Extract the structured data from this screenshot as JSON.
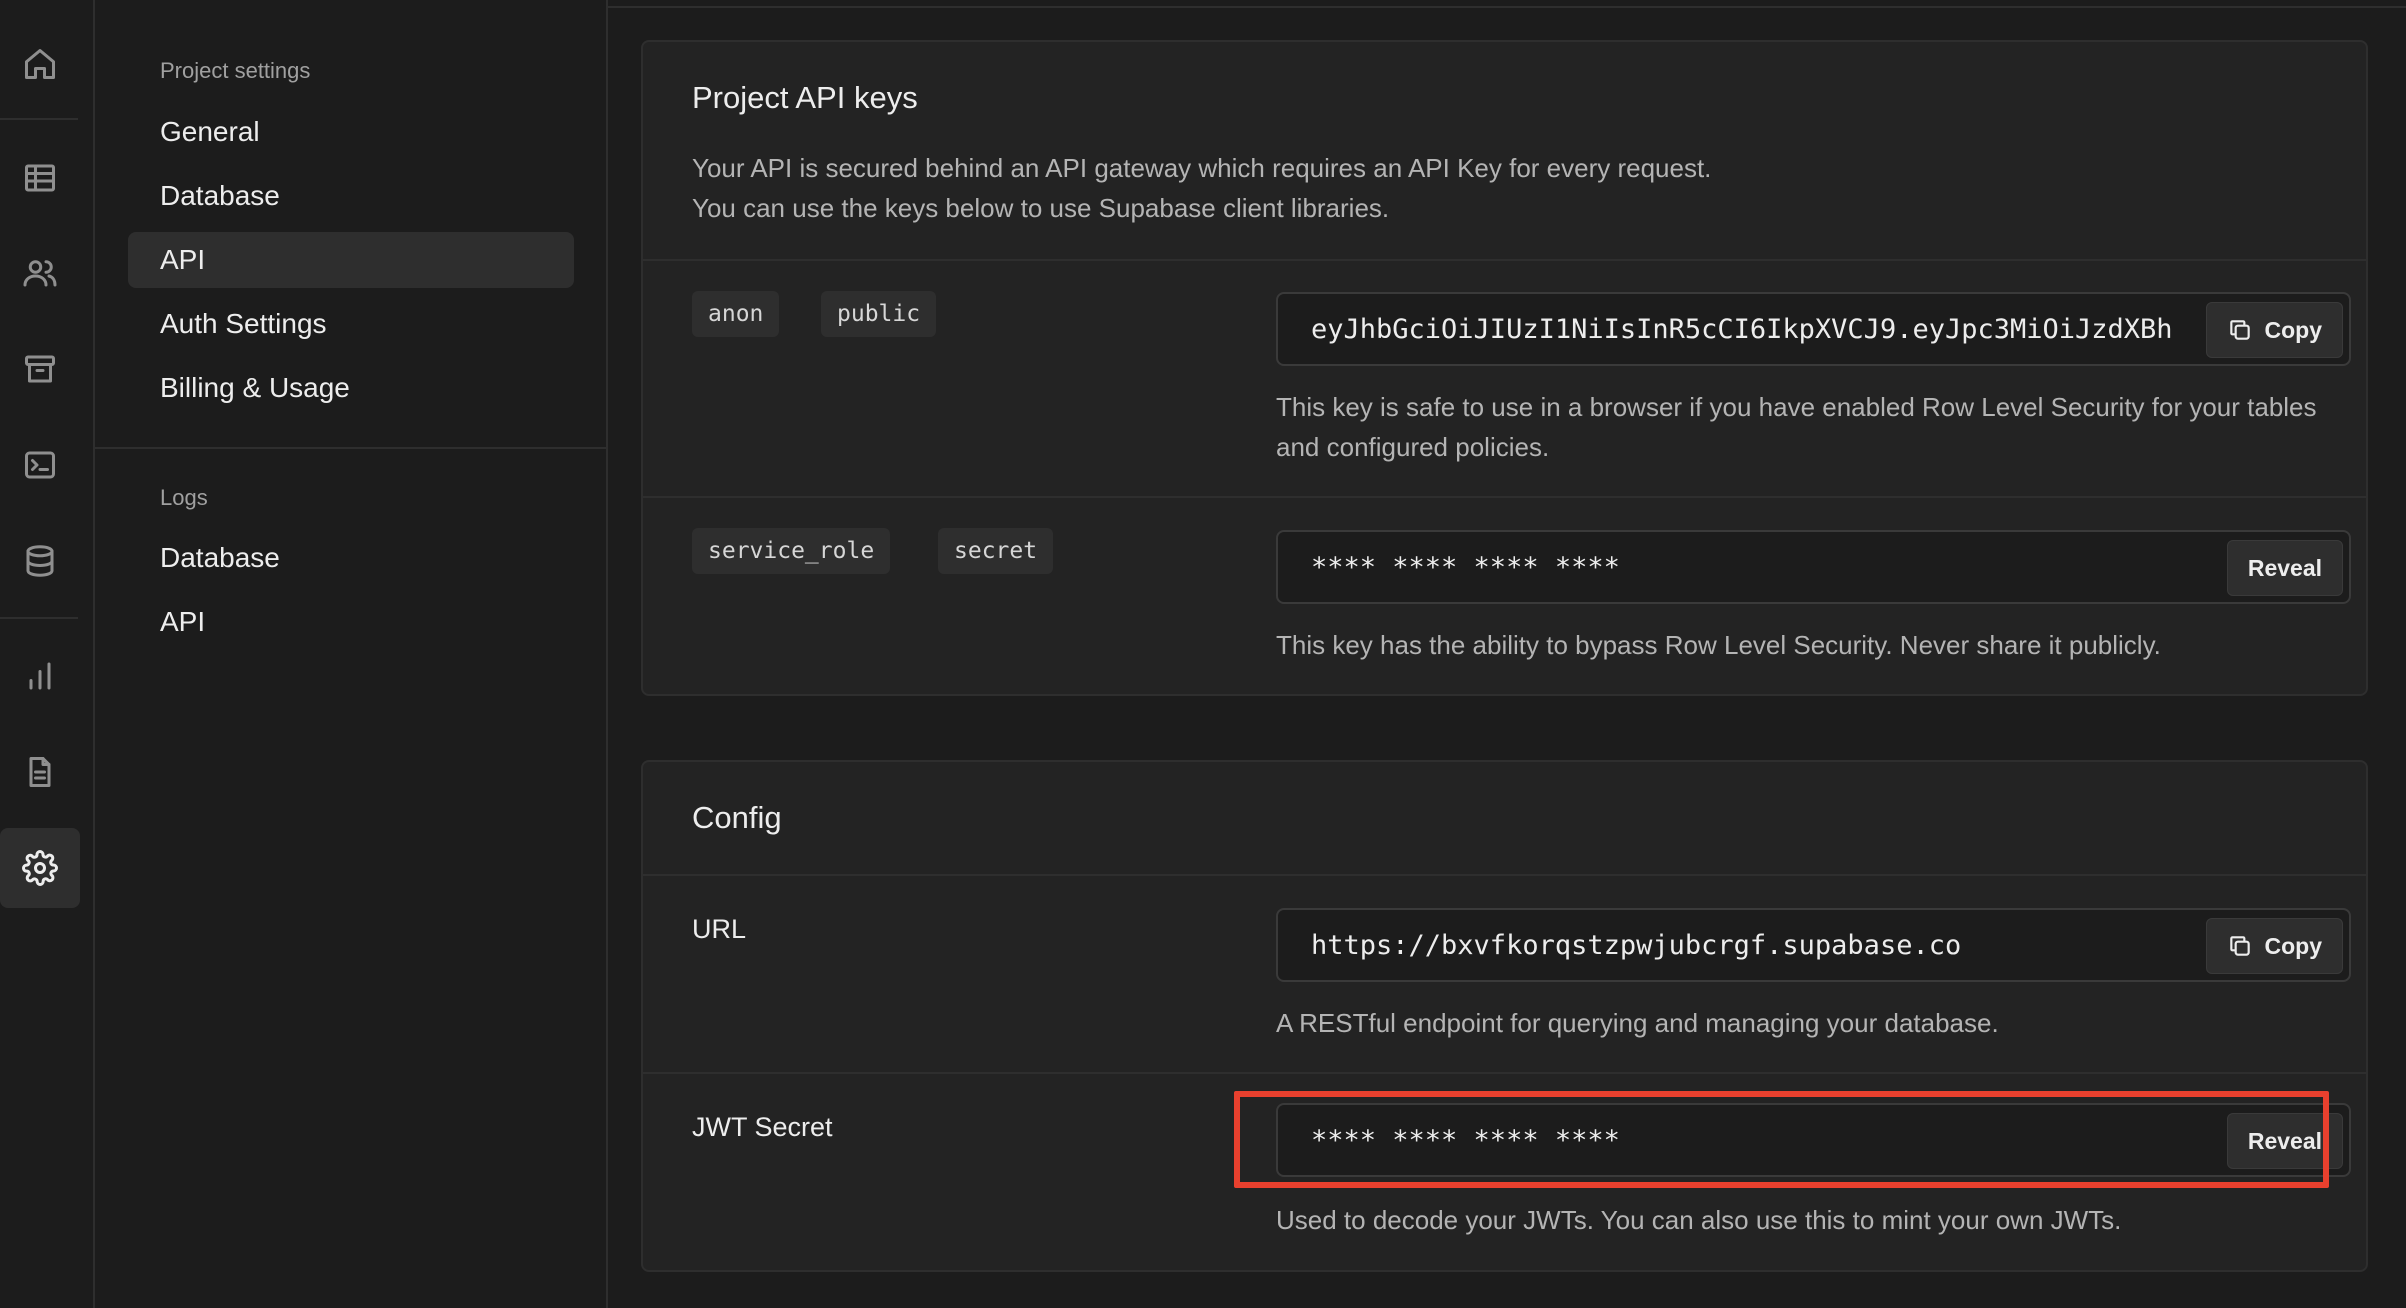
{
  "rail": {
    "items": [
      {
        "icon": "home-icon"
      },
      {
        "icon": "table-editor-icon"
      },
      {
        "icon": "users-icon"
      },
      {
        "icon": "storage-icon"
      },
      {
        "icon": "sql-editor-icon"
      },
      {
        "icon": "database-icon"
      },
      {
        "icon": "reports-icon"
      },
      {
        "icon": "logs-icon"
      },
      {
        "icon": "settings-icon",
        "active": true
      }
    ]
  },
  "sidebar": {
    "project_settings_title": "Project settings",
    "project_items": [
      "General",
      "Database",
      "API",
      "Auth Settings",
      "Billing & Usage"
    ],
    "active_item": "API",
    "logs_title": "Logs",
    "logs_items": [
      "Database",
      "API"
    ]
  },
  "api_keys": {
    "title": "Project API keys",
    "description_line1": "Your API is secured behind an API gateway which requires an API Key for every request.",
    "description_line2": "You can use the keys below to use Supabase client libraries.",
    "anon": {
      "tags": [
        "anon",
        "public"
      ],
      "value": "eyJhbGciOiJIUzI1NiIsInR5cCI6IkpXVCJ9.eyJpc3MiOiJzdXBh",
      "button": "Copy",
      "help": "This key is safe to use in a browser if you have enabled Row Level Security for your tables and configured policies."
    },
    "service": {
      "tags": [
        "service_role",
        "secret"
      ],
      "value": "**** **** **** ****",
      "button": "Reveal",
      "help": "This key has the ability to bypass Row Level Security. Never share it publicly."
    }
  },
  "config": {
    "title": "Config",
    "url": {
      "label": "URL",
      "value": "https://bxvfkorqstzpwjubcrgf.supabase.co",
      "button": "Copy",
      "help": "A RESTful endpoint for querying and managing your database."
    },
    "jwt": {
      "label": "JWT Secret",
      "value": "**** **** **** ****",
      "button": "Reveal",
      "help": "Used to decode your JWTs. You can also use this to mint your own JWTs."
    }
  },
  "colors": {
    "background": "#1c1c1c",
    "panel": "#232323",
    "highlight": "#e8402e"
  }
}
